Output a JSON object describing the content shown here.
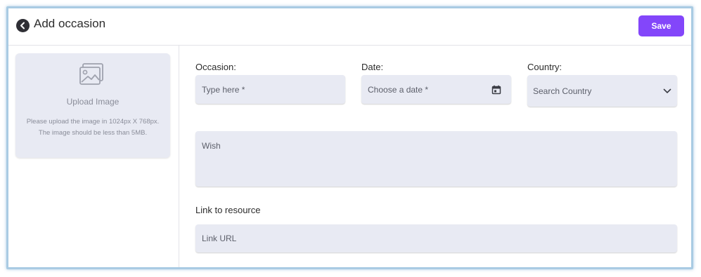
{
  "header": {
    "title": "Add occasion",
    "save_label": "Save"
  },
  "upload": {
    "title": "Upload Image",
    "help": "Please upload the image in 1024px X 768px. The image should be less than 5MB."
  },
  "form": {
    "occasion": {
      "label": "Occasion:",
      "placeholder": "Type here *",
      "value": ""
    },
    "date": {
      "label": "Date:",
      "placeholder": "Choose a date *",
      "value": ""
    },
    "country": {
      "label": "Country:",
      "placeholder": "Search Country",
      "value": ""
    },
    "wish": {
      "placeholder": "Wish",
      "value": ""
    },
    "link": {
      "label": "Link to resource",
      "placeholder": "Link URL",
      "value": ""
    }
  },
  "icons": {
    "back": "chevron-left-icon",
    "image": "image-icon",
    "calendar": "calendar-icon",
    "dropdown": "chevron-down-icon"
  },
  "colors": {
    "accent": "#8346fa",
    "field_background": "#e8eaf3",
    "frame_border": "#a9cbe3"
  }
}
